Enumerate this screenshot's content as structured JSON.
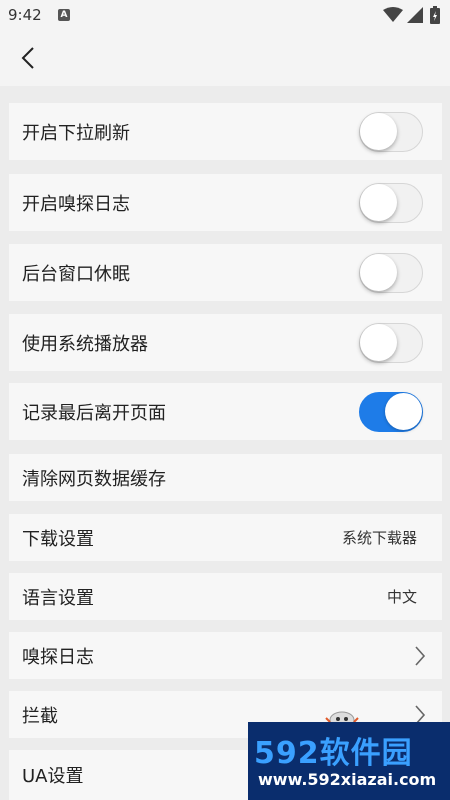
{
  "status_bar": {
    "time": "9:42",
    "notification_icon": "a-badge-icon"
  },
  "app_bar": {
    "back_icon": "back-arrow-icon"
  },
  "settings": [
    {
      "label": "开启下拉刷新",
      "type": "toggle",
      "on": false
    },
    {
      "label": "开启嗅探日志",
      "type": "toggle",
      "on": false
    },
    {
      "label": "后台窗口休眠",
      "type": "toggle",
      "on": false
    },
    {
      "label": "使用系统播放器",
      "type": "toggle",
      "on": false
    },
    {
      "label": "记录最后离开页面",
      "type": "toggle",
      "on": true
    },
    {
      "label": "清除网页数据缓存",
      "type": "action"
    },
    {
      "label": "下载设置",
      "type": "value",
      "value": "系统下载器"
    },
    {
      "label": "语言设置",
      "type": "value",
      "value": "中文"
    },
    {
      "label": "嗅探日志",
      "type": "nav"
    },
    {
      "label": "拦截",
      "type": "nav"
    },
    {
      "label": "UA设置",
      "type": "nav"
    }
  ],
  "watermark": {
    "main": "592软件园",
    "sub": "www.592xiazai.com"
  },
  "colors": {
    "accent": "#1e7ce8",
    "background": "#ececec",
    "row": "#f7f7f7"
  }
}
